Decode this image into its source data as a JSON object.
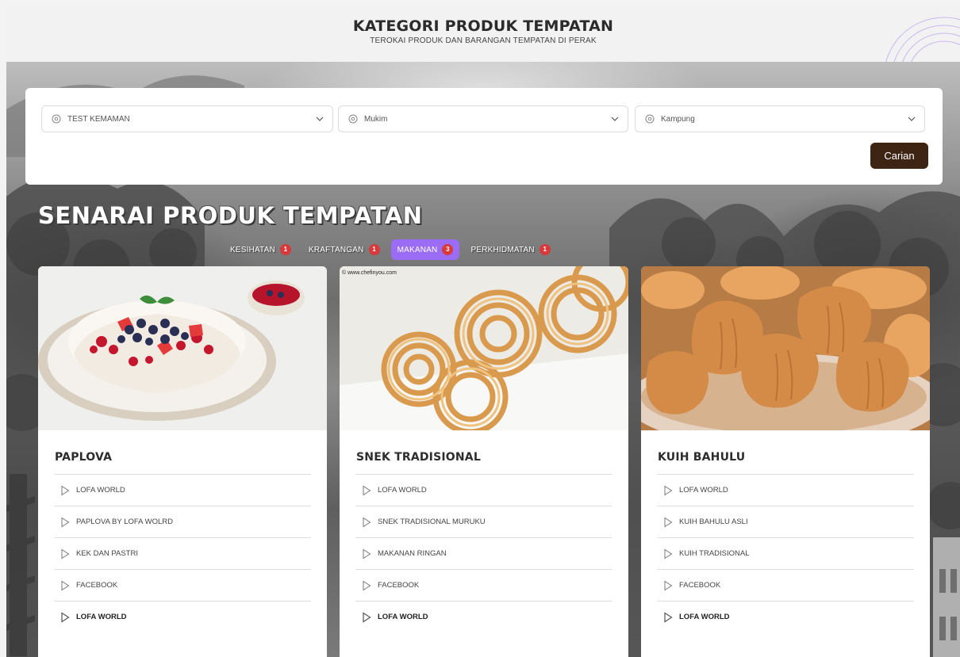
{
  "header": {
    "title": "KATEGORI PRODUK TEMPATAN",
    "subtitle": "TEROKAI PRODUK DAN BARANGAN TEMPATAN DI PERAK"
  },
  "filters": {
    "district": {
      "value": "TEST KEMAMAN",
      "icon": "location-pin-icon"
    },
    "mukim": {
      "value": "Mukim",
      "icon": "location-pin-icon"
    },
    "kampung": {
      "value": "Kampung",
      "icon": "location-pin-icon"
    },
    "search_label": "Carian"
  },
  "section": {
    "title": "SENARAI PRODUK TEMPATAN",
    "tabs": [
      {
        "label": "KESIHATAN",
        "count": "1",
        "active": false
      },
      {
        "label": "KRAFTANGAN",
        "count": "1",
        "active": false
      },
      {
        "label": "MAKANAN",
        "count": "3",
        "active": true
      },
      {
        "label": "PERKHIDMATAN",
        "count": "1",
        "active": false
      }
    ]
  },
  "products": [
    {
      "name": "PAPLOVA",
      "image": "pavlova-photo",
      "links": [
        "LOFA WORLD",
        "PAPLOVA BY LOFA WOLRD",
        "KEK DAN PASTRI",
        "FACEBOOK",
        "LOFA WORLD"
      ]
    },
    {
      "name": "SNEK TRADISIONAL",
      "image": "murukku-photo",
      "credit": "© www.chefinyou.com",
      "links": [
        "LOFA WORLD",
        "SNEK TRADISIONAL MURUKU",
        "MAKANAN RINGAN",
        "FACEBOOK",
        "LOFA WORLD"
      ]
    },
    {
      "name": "KUIH BAHULU",
      "image": "kuih-bahulu-photo",
      "links": [
        "LOFA WORLD",
        "KUIH BAHULU ASLI",
        "KUIH TRADISIONAL",
        "FACEBOOK",
        "LOFA WORLD"
      ]
    }
  ],
  "colors": {
    "search_button": "#3e2413",
    "active_tab": "#9b6cf6",
    "badge": "#d9393b"
  }
}
